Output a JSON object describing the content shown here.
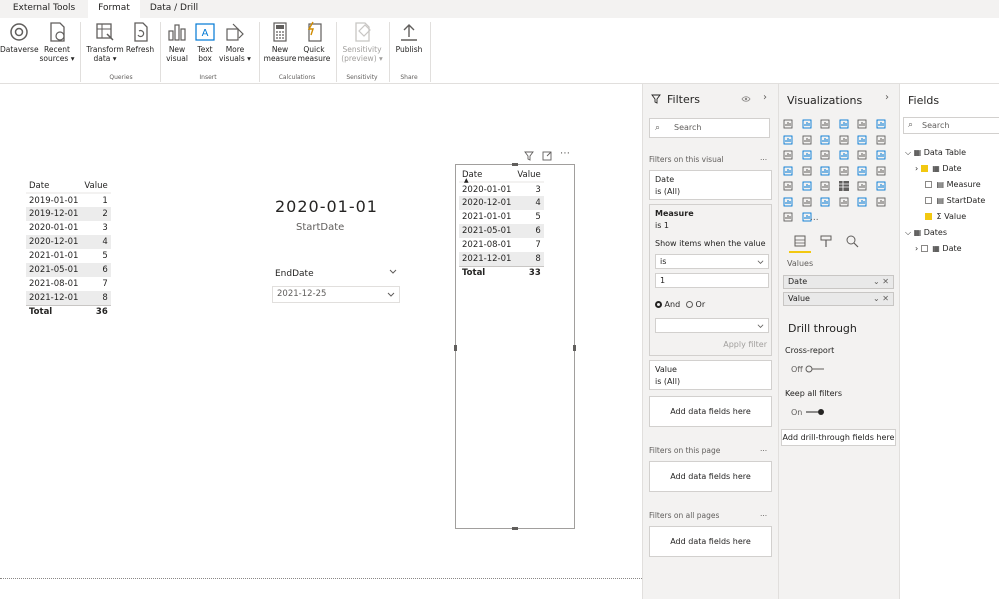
{
  "tabs": [
    {
      "label": "External Tools",
      "active": false
    },
    {
      "label": "Format",
      "active": true
    },
    {
      "label": "Data / Drill",
      "active": false
    }
  ],
  "ribbon": {
    "buttons": [
      {
        "name": "dataverse-button",
        "icon": "dataverse-icon",
        "line1": "Dataverse",
        "line2": "",
        "disabled": false
      },
      {
        "name": "recent-sources-button",
        "icon": "recent-sources-icon",
        "line1": "Recent",
        "line2": "sources ▾",
        "disabled": false
      },
      {
        "name": "transform-data-button",
        "icon": "transform-data-icon",
        "line1": "Transform",
        "line2": "data ▾",
        "disabled": false
      },
      {
        "name": "refresh-button",
        "icon": "refresh-icon",
        "line1": "Refresh",
        "line2": "",
        "disabled": false
      },
      {
        "name": "new-visual-button",
        "icon": "new-visual-icon",
        "line1": "New",
        "line2": "visual",
        "disabled": false
      },
      {
        "name": "text-box-button",
        "icon": "text-box-icon",
        "line1": "Text",
        "line2": "box",
        "disabled": false
      },
      {
        "name": "more-visuals-button",
        "icon": "more-visuals-icon",
        "line1": "More",
        "line2": "visuals ▾",
        "disabled": false
      },
      {
        "name": "new-measure-button",
        "icon": "calculator-icon",
        "line1": "New",
        "line2": "measure",
        "disabled": false
      },
      {
        "name": "quick-measure-button",
        "icon": "quick-measure-icon",
        "line1": "Quick",
        "line2": "measure",
        "disabled": false
      },
      {
        "name": "sensitivity-button",
        "icon": "sensitivity-icon",
        "line1": "Sensitivity",
        "line2": "(preview) ▾",
        "disabled": true
      },
      {
        "name": "publish-button",
        "icon": "publish-icon",
        "line1": "Publish",
        "line2": "",
        "disabled": false
      }
    ],
    "groups": [
      "Queries",
      "Insert",
      "Calculations",
      "Sensitivity",
      "Share"
    ]
  },
  "table1": {
    "headers": [
      "Date",
      "Value"
    ],
    "rows": [
      [
        "2019-01-01",
        "1"
      ],
      [
        "2019-12-01",
        "2"
      ],
      [
        "2020-01-01",
        "3"
      ],
      [
        "2020-12-01",
        "4"
      ],
      [
        "2021-01-01",
        "5"
      ],
      [
        "2021-05-01",
        "6"
      ],
      [
        "2021-08-01",
        "7"
      ],
      [
        "2021-12-01",
        "8"
      ]
    ],
    "total": [
      "Total",
      "36"
    ]
  },
  "card": {
    "value": "2020-01-01",
    "label": "StartDate"
  },
  "slicer": {
    "title": "EndDate",
    "value": "2021-12-25"
  },
  "table2": {
    "headers": [
      "Date",
      "Value"
    ],
    "rows": [
      [
        "2020-01-01",
        "3"
      ],
      [
        "2020-12-01",
        "4"
      ],
      [
        "2021-01-01",
        "5"
      ],
      [
        "2021-05-01",
        "6"
      ],
      [
        "2021-08-01",
        "7"
      ],
      [
        "2021-12-01",
        "8"
      ]
    ],
    "total": [
      "Total",
      "33"
    ]
  },
  "filters": {
    "title": "Filters",
    "search_placeholder": "Search",
    "on_visual_label": "Filters on this visual",
    "date_card": {
      "name": "Date",
      "state": "is (All)"
    },
    "measure_card": {
      "name": "Measure",
      "state": "is 1",
      "show_items": "Show items when the value",
      "operator": "is",
      "operand": "1",
      "and_label": "And",
      "or_label": "Or",
      "apply_label": "Apply filter"
    },
    "value_card": {
      "name": "Value",
      "state": "is (All)"
    },
    "add_fields": "Add data fields here",
    "on_page_label": "Filters on this page",
    "on_all_pages_label": "Filters on all pages",
    "more": "..."
  },
  "viz": {
    "title": "Visualizations",
    "values_label": "Values",
    "wells": [
      "Date",
      "Value"
    ],
    "drill_title": "Drill through",
    "cross_report": "Cross-report",
    "off_label": "Off",
    "keep_filters": "Keep all filters",
    "on_label": "On",
    "add_drill": "Add drill-through fields here",
    "more": "..."
  },
  "fields": {
    "title": "Fields",
    "search_placeholder": "Search",
    "tables": [
      {
        "name": "Data Table",
        "items": [
          "Date",
          "Measure",
          "StartDate",
          "Σ Value"
        ]
      },
      {
        "name": "Dates",
        "items": [
          "Date"
        ]
      }
    ]
  },
  "colors": {
    "accent": "#f2c811",
    "pane": "#f3f2f1",
    "border": "#e1dfdd"
  }
}
